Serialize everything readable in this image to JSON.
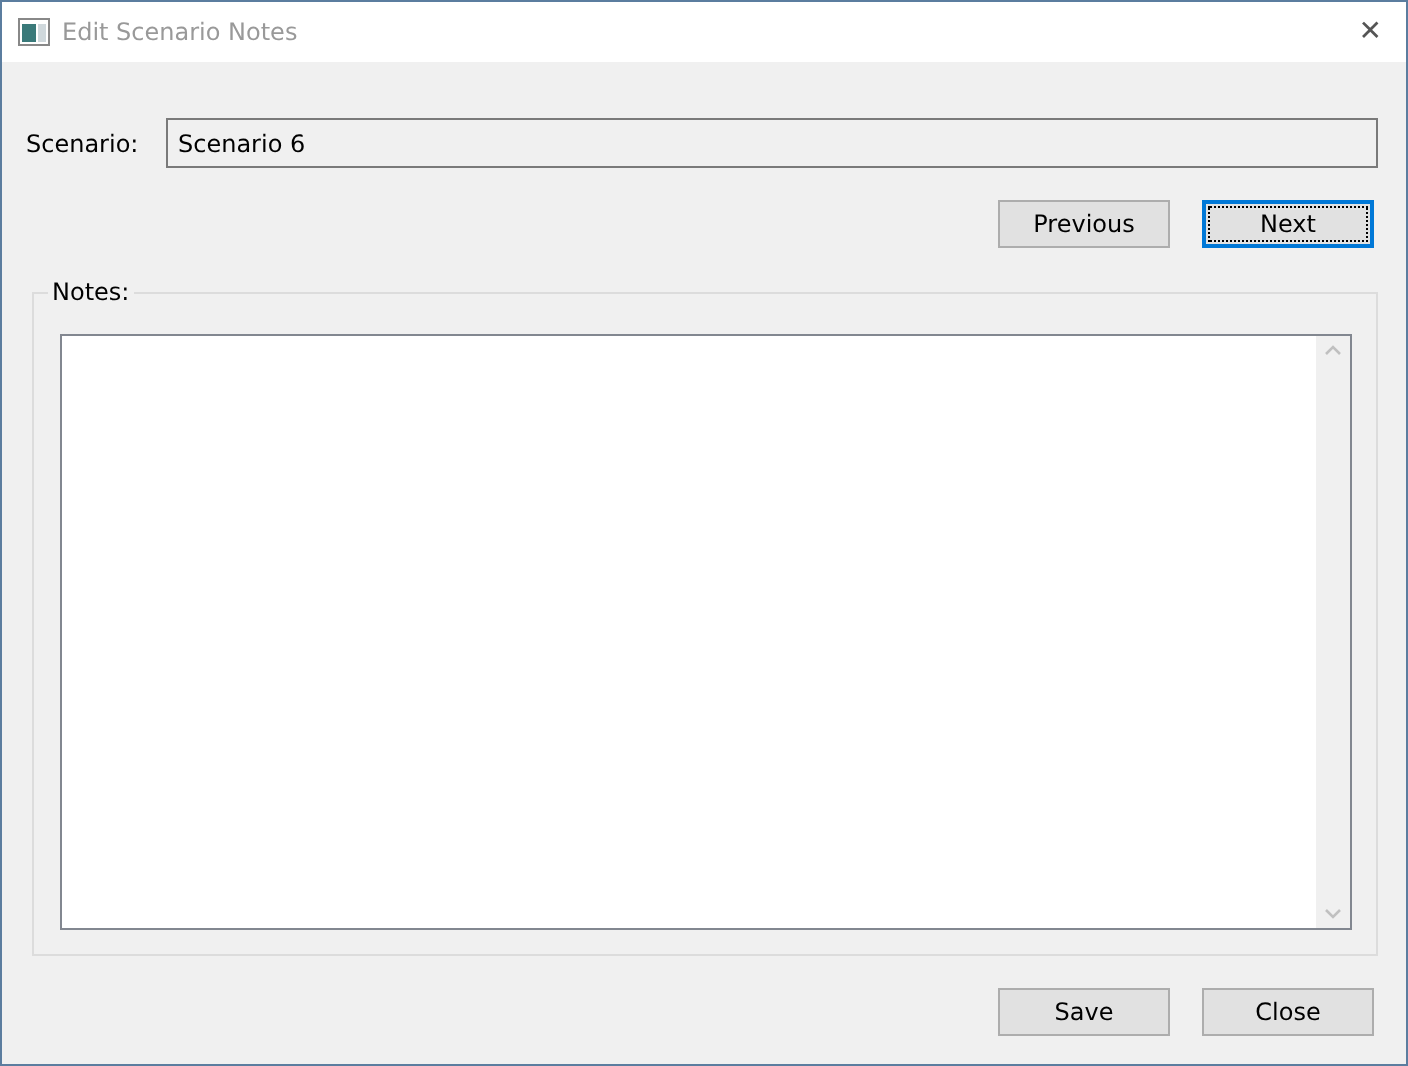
{
  "window": {
    "title": "Edit Scenario Notes",
    "close": "✕"
  },
  "scenario": {
    "label": "Scenario:",
    "value": "Scenario 6",
    "readonly": true
  },
  "nav_buttons": [
    {
      "label": "Previous",
      "focused": false
    },
    {
      "label": "Next",
      "focused": true
    }
  ],
  "notes": {
    "label": "Notes:"
  },
  "footer_buttons": [
    {
      "label": "Save",
      "focused": false
    },
    {
      "label": "Close",
      "focused": false
    }
  ]
}
